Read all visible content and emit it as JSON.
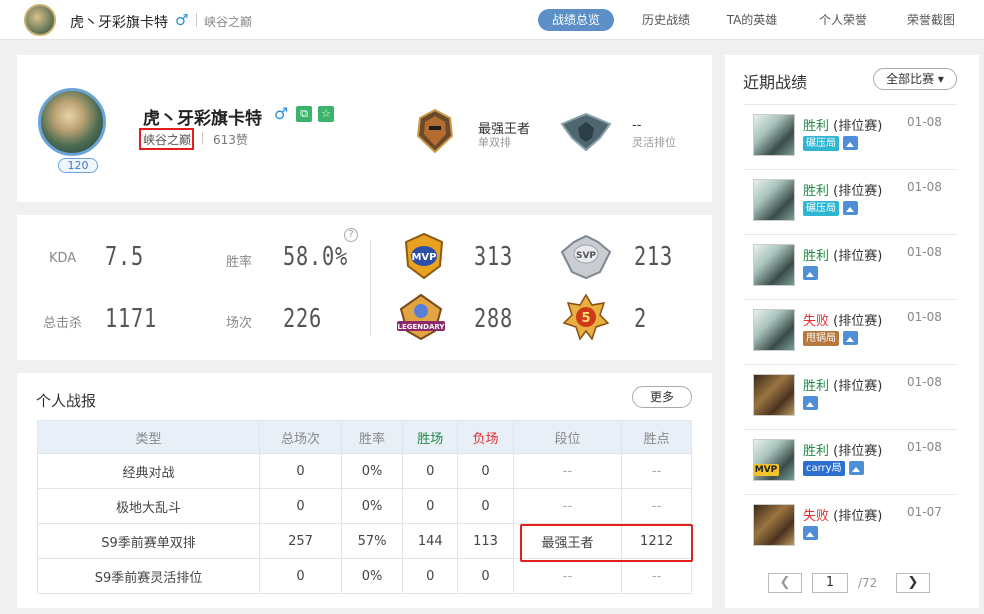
{
  "topbar": {
    "name": "虎丶牙彩旗卡特",
    "gender": "♂",
    "server": "峡谷之巅",
    "nav": [
      "战绩总览",
      "历史战绩",
      "TA的英雄",
      "个人荣誉",
      "荣誉截图"
    ]
  },
  "profile": {
    "name": "虎丶牙彩旗卡特",
    "gender": "♂",
    "level": "120",
    "server": "峡谷之巅",
    "likes": "613赞",
    "rank_solo": {
      "title": "最强王者",
      "sub": "单双排"
    },
    "rank_flex": {
      "title": "--",
      "sub": "灵活排位"
    }
  },
  "stats": {
    "kda_label": "KDA",
    "kda": "7.5",
    "winrate_label": "胜率",
    "winrate": "58.0%",
    "help": "?",
    "kills_label": "总击杀",
    "kills": "1171",
    "games_label": "场次",
    "games": "226",
    "mvp": "313",
    "svp": "213",
    "legendary": "288",
    "penta": "2"
  },
  "report": {
    "title": "个人战报",
    "more": "更多",
    "headers": [
      "类型",
      "总场次",
      "胜率",
      "胜场",
      "负场",
      "段位",
      "胜点"
    ],
    "rows": [
      [
        "经典对战",
        "0",
        "0%",
        "0",
        "0",
        "--",
        "--"
      ],
      [
        "极地大乱斗",
        "0",
        "0%",
        "0",
        "0",
        "--",
        "--"
      ],
      [
        "S9季前赛单双排",
        "257",
        "57%",
        "144",
        "113",
        "最强王者",
        "1212"
      ],
      [
        "S9季前赛灵活排位",
        "0",
        "0%",
        "0",
        "0",
        "--",
        "--"
      ]
    ]
  },
  "recent": {
    "title": "近期战绩",
    "filter": "全部比赛 ▾",
    "matches": [
      {
        "result": "胜利",
        "mode": "(排位赛)",
        "date": "01-08",
        "tag": "碾压局"
      },
      {
        "result": "胜利",
        "mode": "(排位赛)",
        "date": "01-08",
        "tag": "碾压局"
      },
      {
        "result": "胜利",
        "mode": "(排位赛)",
        "date": "01-08"
      },
      {
        "result": "失败",
        "mode": "(排位赛)",
        "date": "01-08",
        "tag": "甩锅局"
      },
      {
        "result": "胜利",
        "mode": "(排位赛)",
        "date": "01-08"
      },
      {
        "result": "胜利",
        "mode": "(排位赛)",
        "date": "01-08",
        "tag": "carry局",
        "badge": "MVP"
      },
      {
        "result": "失败",
        "mode": "(排位赛)",
        "date": "01-07"
      }
    ],
    "page": "1",
    "total": "/72"
  },
  "colors": {
    "win": "#1e8a44",
    "loss": "#e03030",
    "accent": "#5b8fc6",
    "highlight": "#e02020"
  }
}
